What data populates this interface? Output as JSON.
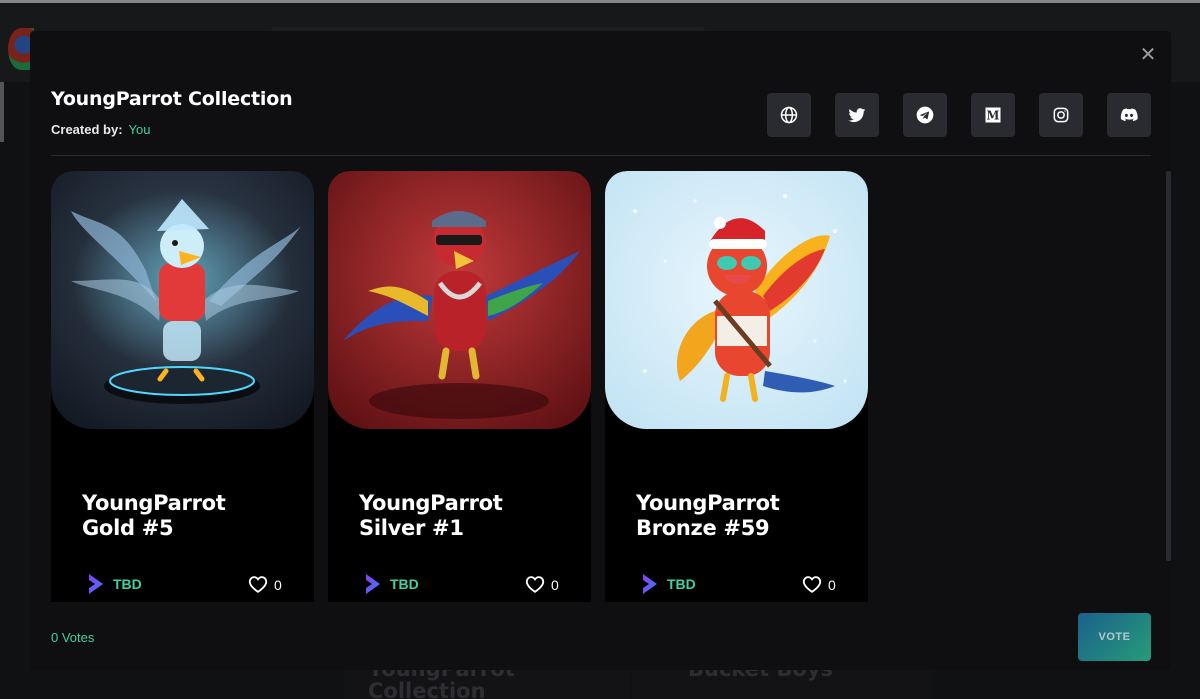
{
  "background": {
    "cards": [
      {
        "title": "YoungParrot\nCollection"
      },
      {
        "title": "Bucket Boys"
      }
    ]
  },
  "modal": {
    "title": "YoungParrot Collection",
    "created_by_label": "Created by:",
    "creator": "You",
    "close_icon": "close-icon",
    "socials": [
      {
        "name": "globe-icon"
      },
      {
        "name": "twitter-icon"
      },
      {
        "name": "telegram-icon"
      },
      {
        "name": "medium-icon"
      },
      {
        "name": "instagram-icon"
      },
      {
        "name": "discord-icon"
      }
    ],
    "nfts": [
      {
        "name": "YoungParrot\nGold #5",
        "currency": "TBD",
        "likes": "0",
        "image": "neon-parrot-on-pedestal"
      },
      {
        "name": "YoungParrot\nSilver #1",
        "currency": "TBD",
        "likes": "0",
        "image": "red-parrot-with-cap"
      },
      {
        "name": "YoungParrot\nBronze #59",
        "currency": "TBD",
        "likes": "0",
        "image": "parrot-with-santa-hat"
      }
    ],
    "votes_text": "0 Votes",
    "vote_button": "VOTE"
  },
  "colors": {
    "accent": "#3fd0a4",
    "modal_bg": "#0f0f12",
    "card_bg": "#000000",
    "social_btn_bg": "#2a2b30"
  }
}
